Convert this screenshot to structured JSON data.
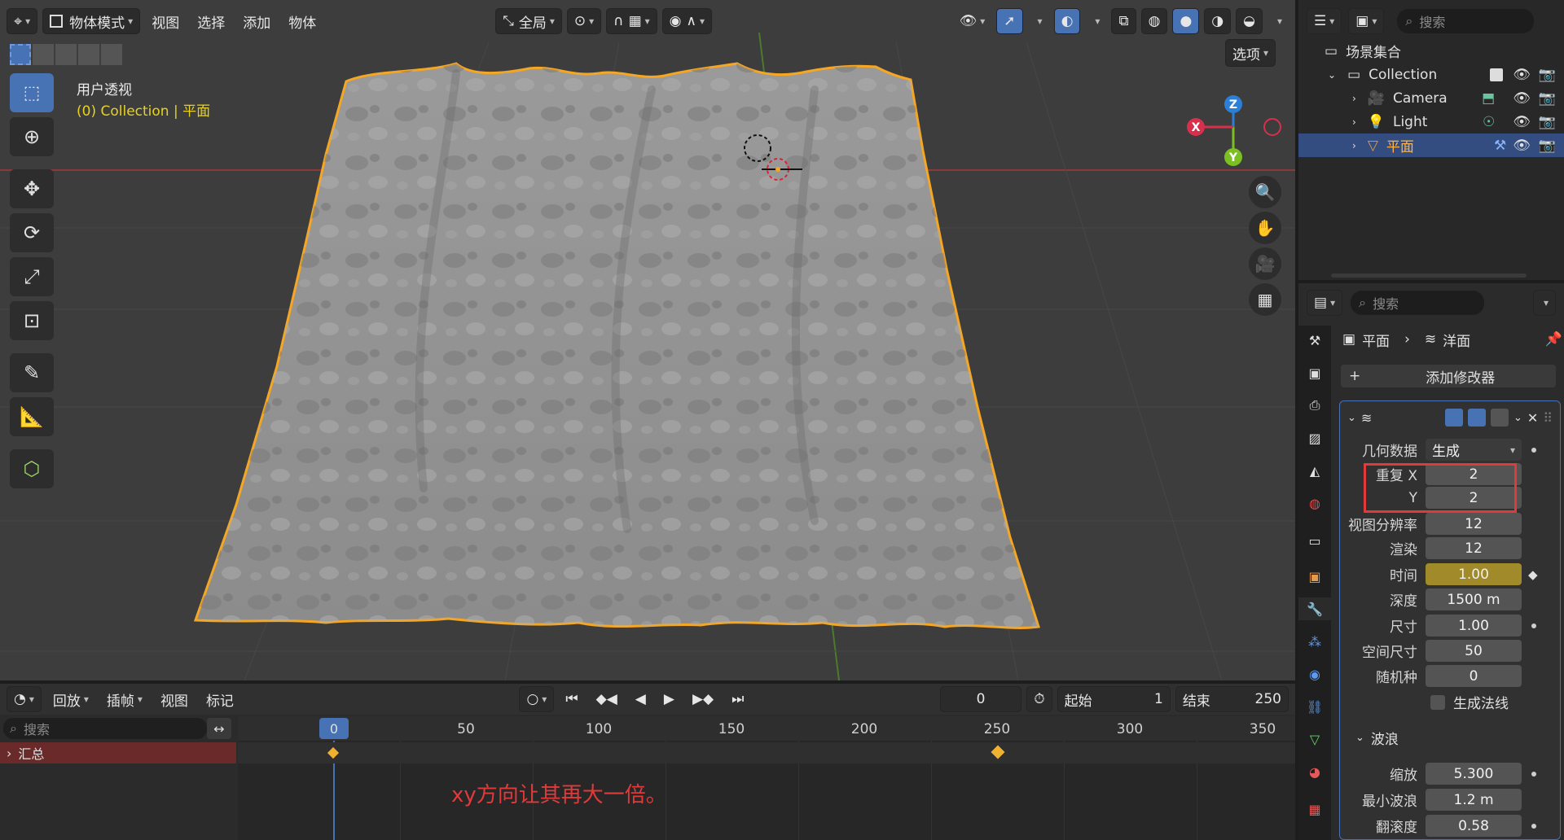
{
  "viewport": {
    "mode_label": "物体模式",
    "menus": [
      "视图",
      "选择",
      "添加",
      "物体"
    ],
    "transform_orientation": "全局",
    "options_label": "选项",
    "view_name": "用户透视",
    "collection_info": "(0) Collection | 平面"
  },
  "outliner": {
    "search_placeholder": "搜索",
    "scene_collection": "场景集合",
    "items": [
      {
        "label": "Collection"
      },
      {
        "label": "Camera"
      },
      {
        "label": "Light"
      },
      {
        "label": "平面"
      }
    ]
  },
  "properties": {
    "search_placeholder": "搜索",
    "breadcrumb_object": "平面",
    "breadcrumb_modifier": "洋面",
    "add_modifier_label": "添加修改器",
    "rows": [
      {
        "label": "几何数据",
        "value": "生成"
      },
      {
        "label": "重复 X",
        "value": "2"
      },
      {
        "label": "Y",
        "value": "2"
      },
      {
        "label": "视图分辨率",
        "value": "12"
      },
      {
        "label": "渲染",
        "value": "12"
      },
      {
        "label": "时间",
        "value": "1.00"
      },
      {
        "label": "深度",
        "value": "1500 m"
      },
      {
        "label": "尺寸",
        "value": "1.00"
      },
      {
        "label": "空间尺寸",
        "value": "50"
      },
      {
        "label": "随机种",
        "value": "0"
      }
    ],
    "generate_normals_label": "生成法线",
    "waves_section": "波浪",
    "wave_rows": [
      {
        "label": "缩放",
        "value": "5.300"
      },
      {
        "label": "最小波浪",
        "value": "1.2 m"
      },
      {
        "label": "翻滚度",
        "value": "0.58"
      }
    ]
  },
  "timeline": {
    "menus": [
      "回放",
      "插帧",
      "视图",
      "标记"
    ],
    "current_frame": "0",
    "start_label": "起始",
    "start_value": "1",
    "end_label": "结束",
    "end_value": "250",
    "search_placeholder": "搜索",
    "summary_label": "汇总",
    "ticks": [
      "0",
      "50",
      "100",
      "150",
      "200",
      "250",
      "300",
      "350"
    ],
    "annotation": "xy方向让其再大一倍。"
  },
  "colors": {
    "accent": "#4772b3",
    "selection_outline": "#f5a623",
    "highlight_box": "#e03a3a",
    "animated_field": "#a08a2a"
  }
}
